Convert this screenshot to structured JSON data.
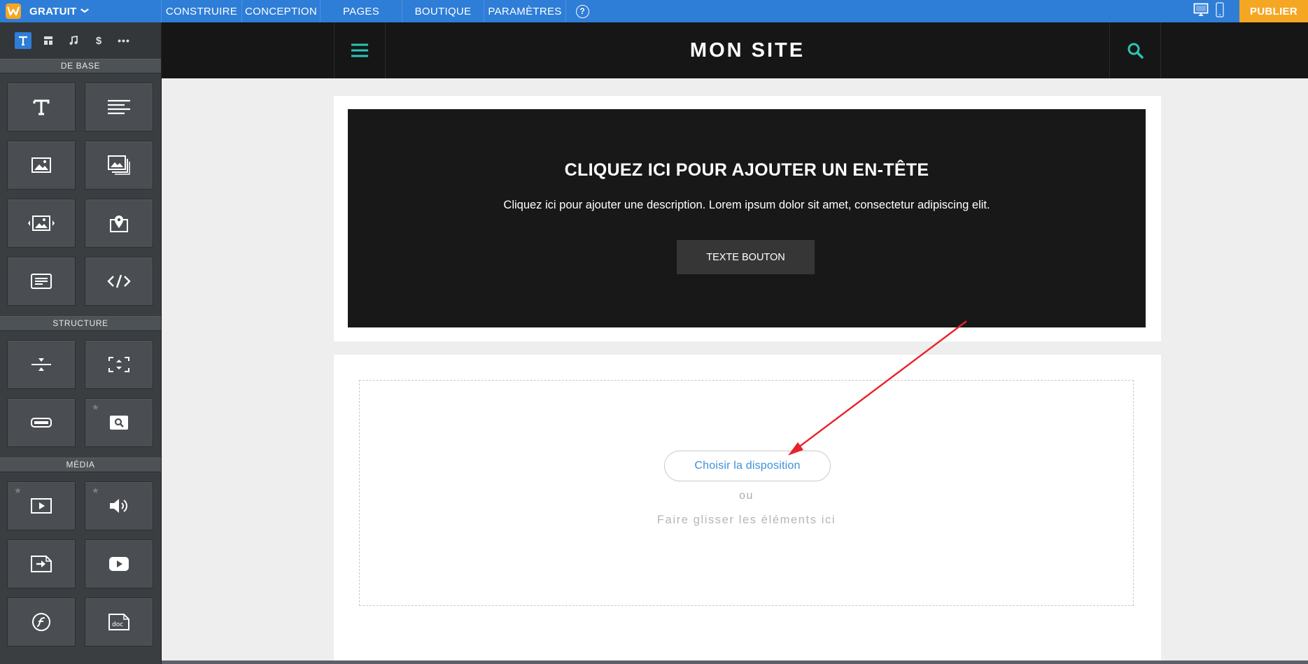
{
  "topbar": {
    "plan_label": "GRATUIT",
    "nav": [
      "CONSTRUIRE",
      "CONCEPTION",
      "PAGES",
      "BOUTIQUE",
      "PARAMÈTRES"
    ],
    "help_label": "?",
    "publish_label": "PUBLIER",
    "colors": {
      "bar": "#2e7dd7",
      "publish": "#f5a623"
    }
  },
  "sidebar": {
    "tabs": [
      "text-tab-icon",
      "layout-tab-icon",
      "music-tab-icon",
      "dollar-tab-icon",
      "more-tab-icon"
    ],
    "sections": {
      "basic": "DE BASE",
      "structure": "STRUCTURE",
      "media": "MÉDIA"
    },
    "basic_tiles": [
      "title-icon",
      "paragraph-icon",
      "image-icon",
      "gallery-icon",
      "slideshow-icon",
      "map-icon",
      "contact-form-icon",
      "embed-code-icon"
    ],
    "structure_tiles": [
      "divider-icon",
      "spacer-icon",
      "button-icon",
      "search-box-icon"
    ],
    "media_tiles": [
      "video-icon",
      "audio-icon",
      "document-upload-icon",
      "youtube-icon",
      "flash-icon",
      "document-icon"
    ]
  },
  "site": {
    "title": "MON SITE",
    "accent": "#2ec4b6",
    "banner": {
      "heading": "CLIQUEZ ICI POUR AJOUTER UN EN-TÊTE",
      "description": "Cliquez ici pour ajouter une description. Lorem ipsum dolor sit amet, consectetur adipiscing elit.",
      "button": "TEXTE BOUTON"
    },
    "dropzone": {
      "layout_button": "Choisir la disposition",
      "or": "ou",
      "drag_hint": "Faire glisser les éléments ici"
    }
  }
}
